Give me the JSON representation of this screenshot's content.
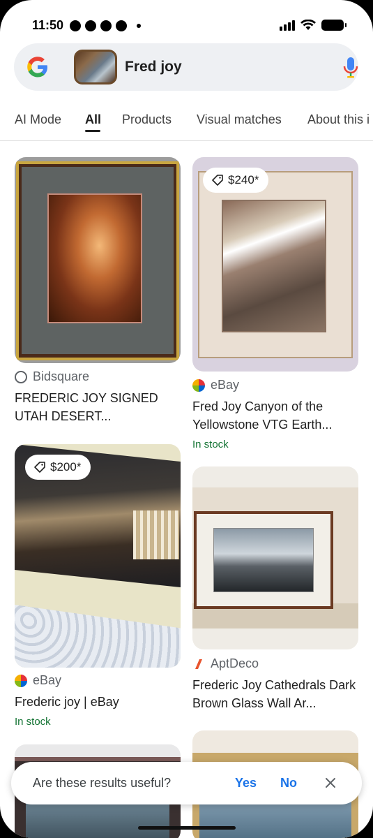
{
  "status_bar": {
    "time": "11:50"
  },
  "search": {
    "query": "Fred joy"
  },
  "tabs": [
    {
      "label": "AI Mode"
    },
    {
      "label": "All"
    },
    {
      "label": "Products"
    },
    {
      "label": "Visual matches"
    },
    {
      "label": "About this i"
    }
  ],
  "results": [
    {
      "source": "Bidsquare",
      "title": "FREDERIC JOY SIGNED UTAH DESERT...",
      "price": "",
      "stock": ""
    },
    {
      "source": "eBay",
      "title": "Fred Joy Canyon of the Yellowstone VTG Earth...",
      "price": "$240*",
      "stock": "In stock"
    },
    {
      "source": "eBay",
      "title": "Frederic joy | eBay",
      "price": "$200*",
      "stock": "In stock"
    },
    {
      "source": "AptDeco",
      "title": "Frederic Joy Cathedrals Dark Brown Glass Wall Ar...",
      "price": "",
      "stock": ""
    }
  ],
  "feedback": {
    "question": "Are these results useful?",
    "yes": "Yes",
    "no": "No"
  },
  "colors": {
    "accent_blue": "#1a73e8",
    "stock_green": "#137333",
    "search_bg": "#eef0f3"
  }
}
